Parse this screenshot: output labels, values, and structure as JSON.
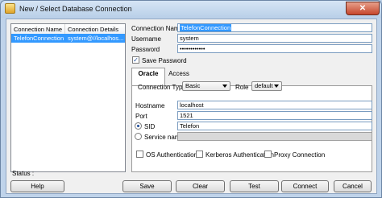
{
  "window": {
    "title": "New / Select Database Connection",
    "close_glyph": "✕"
  },
  "conn_list": {
    "columns": [
      "Connection Name",
      "Connection Details"
    ],
    "rows": [
      {
        "name": "TelefonConnection",
        "details": "system@//localhos..."
      }
    ]
  },
  "form": {
    "connection_name_label": "Connection Name",
    "connection_name_value": "TelefonConnection",
    "username_label": "Username",
    "username_value": "system",
    "password_label": "Password",
    "password_value": "••••••••••••",
    "save_password_label": "Save Password",
    "save_password_checked": true
  },
  "tabs": {
    "oracle": "Oracle",
    "access": "Access"
  },
  "oracle": {
    "connection_type_label": "Connection Type",
    "connection_type_value": "Basic",
    "role_label": "Role",
    "role_value": "default",
    "hostname_label": "Hostname",
    "hostname_value": "localhost",
    "port_label": "Port",
    "port_value": "1521",
    "sid_label": "SID",
    "sid_value": "Telefon",
    "service_name_label": "Service name",
    "os_auth_label": "OS Authentication",
    "kerberos_label": "Kerberos Authentication",
    "proxy_label": "Proxy Connection"
  },
  "status": {
    "label": "Status :"
  },
  "buttons": {
    "help": "Help",
    "save": "Save",
    "clear": "Clear",
    "test": "Test",
    "connect": "Connect",
    "cancel": "Cancel"
  }
}
